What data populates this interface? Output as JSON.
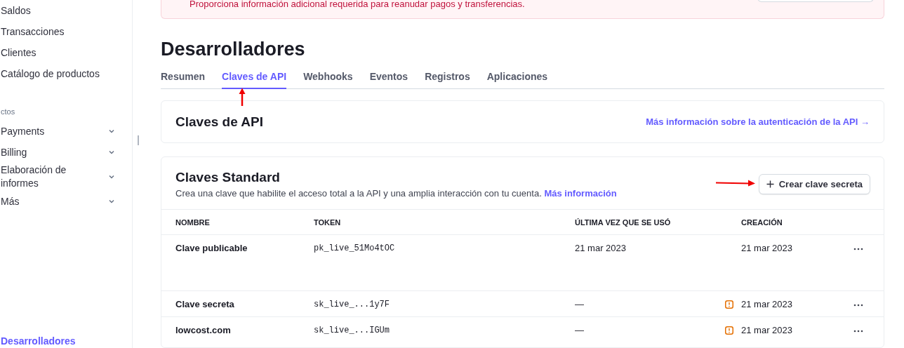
{
  "sidebar": {
    "items": [
      {
        "label": "Saldos",
        "kind": "link"
      },
      {
        "label": "Transacciones",
        "kind": "link"
      },
      {
        "label": "Clientes",
        "kind": "link"
      },
      {
        "label": "Catálogo de productos",
        "kind": "link"
      },
      {
        "label": "ctos",
        "kind": "section"
      },
      {
        "label": "Payments",
        "kind": "group",
        "expanded": false
      },
      {
        "label": "Billing",
        "kind": "group",
        "expanded": false
      },
      {
        "label": "Elaboración de informes",
        "kind": "group",
        "expanded": false
      },
      {
        "label": "Más",
        "kind": "group",
        "expanded": false
      }
    ],
    "footer": {
      "label": "Desarrolladores",
      "selected": true
    }
  },
  "banner": {
    "text": "Proporciona información adicional requerida para reanudar pagos y transferencias."
  },
  "page_title": "Desarrolladores",
  "tabs": [
    {
      "label": "Resumen",
      "selected": false
    },
    {
      "label": "Claves de API",
      "selected": true
    },
    {
      "label": "Webhooks",
      "selected": false
    },
    {
      "label": "Eventos",
      "selected": false
    },
    {
      "label": "Registros",
      "selected": false
    },
    {
      "label": "Aplicaciones",
      "selected": false
    }
  ],
  "api_card": {
    "title": "Claves de API",
    "link": "Más información sobre la autenticación de la API →"
  },
  "standard_card": {
    "title": "Claves Standard",
    "description": "Crea una clave que habilite el acceso total a la API y una amplia interacción con tu cuenta.",
    "link": "Más información",
    "button": "Crear clave secreta",
    "columns": [
      "NOMBRE",
      "TOKEN",
      "ÚLTIMA VEZ QUE SE USÓ",
      "CREACIÓN"
    ],
    "rows": [
      {
        "name": "Clave publicable",
        "token": "pk_live_51Mo4tOC",
        "last_used": "21 mar 2023",
        "warning": false,
        "created": "21 mar 2023"
      },
      {
        "name": "Clave secreta",
        "token": "sk_live_...1y7F",
        "last_used": "—",
        "warning": true,
        "created": "21 mar 2023"
      },
      {
        "name": "lowcost.com",
        "token": "sk_live_...IGUm",
        "last_used": "—",
        "warning": true,
        "created": "21 mar 2023"
      }
    ]
  }
}
